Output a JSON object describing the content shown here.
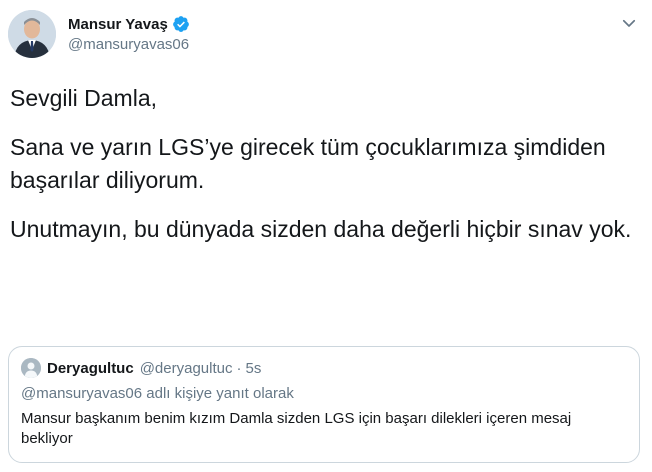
{
  "tweet": {
    "author": {
      "name": "Mansur Yavaş",
      "handle": "@mansuryavas06",
      "verified": true
    },
    "paragraphs": [
      "Sevgili Damla,",
      "Sana ve yarın LGS’ye girecek tüm çocuklarımıza şimdiden başarılar diliyorum.",
      "Unutmayın, bu dünyada sizden daha değerli hiçbir sınav yok."
    ],
    "quoted": {
      "name": "Deryagultuc",
      "handle": "@deryagultuc",
      "separator": "·",
      "time": "5s",
      "reply_context": "@mansuryavas06 adlı kişiye yanıt olarak",
      "text": "Mansur başkanım benim kızım Damla sizden LGS için başarı dilekleri içeren mesaj bekliyor"
    }
  },
  "icons": {
    "verified": "verified-badge-icon",
    "menu": "chevron-down-icon"
  },
  "colors": {
    "primary_text": "#14171a",
    "secondary_text": "#657786",
    "verified_blue": "#1da1f2",
    "border": "#ccd6dd"
  }
}
